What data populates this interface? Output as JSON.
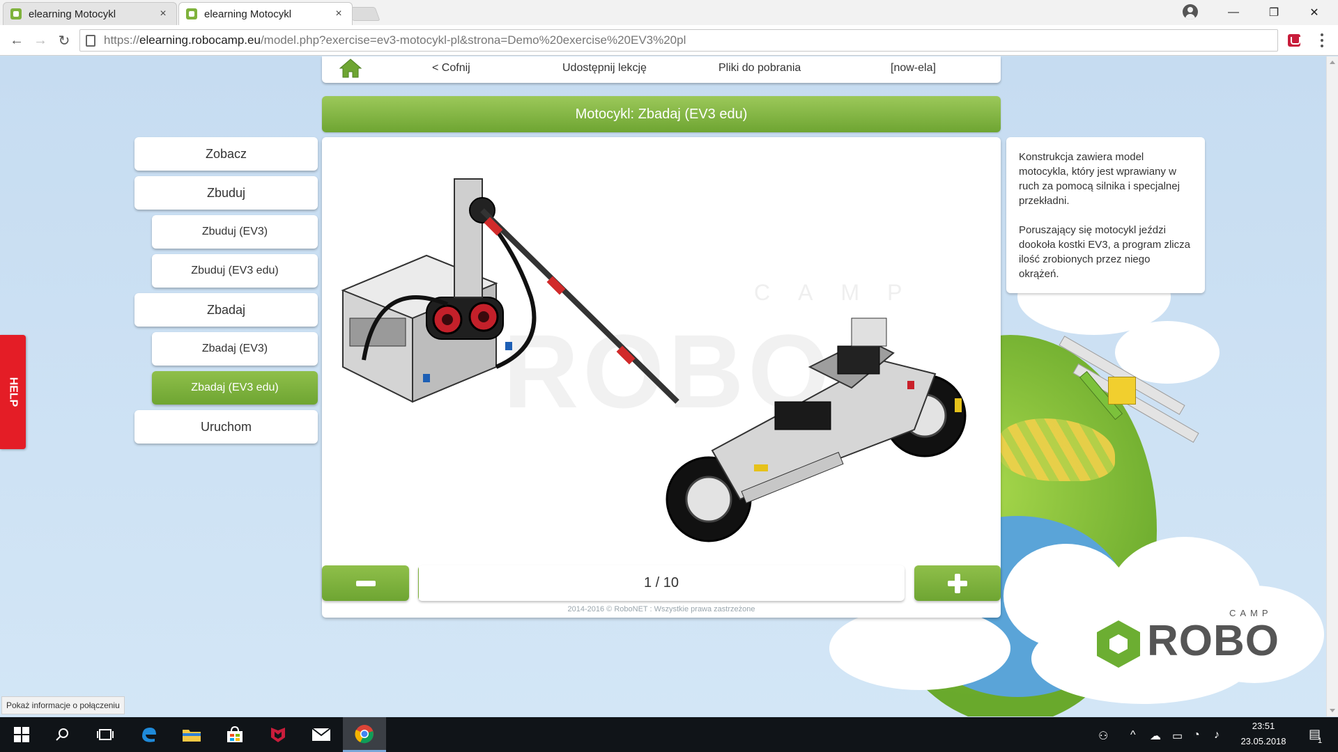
{
  "browser": {
    "tabs": [
      {
        "title": "elearning Motocykl",
        "close": "×"
      },
      {
        "title": "elearning Motocykl",
        "close": "×"
      }
    ],
    "url": {
      "scheme": "https://",
      "host": "elearning.robocamp.eu",
      "path": "/model.php?exercise=ev3-motocykl-pl&strona=Demo%20exercise%20EV3%20pl"
    },
    "window_controls": {
      "minimize": "—",
      "maximize": "❐",
      "close": "✕"
    }
  },
  "topnav": {
    "back": "< Cofnij",
    "share": "Udostępnij lekcję",
    "downloads": "Pliki do pobrania",
    "user": "[now-ela]"
  },
  "lesson": {
    "title": "Motocykl: Zbadaj (EV3 edu)"
  },
  "menu": {
    "see": "Zobacz",
    "build": "Zbuduj",
    "build_ev3": "Zbuduj (EV3)",
    "build_ev3_edu": "Zbuduj (EV3 edu)",
    "explore": "Zbadaj",
    "explore_ev3": "Zbadaj (EV3)",
    "explore_ev3_edu": "Zbadaj (EV3 edu)",
    "run": "Uruchom"
  },
  "description": {
    "p1": "Konstrukcja zawiera model motocykla, który jest wprawiany w ruch za pomocą silnika i specjalnej przekładni.",
    "p2": "Poruszający się motocykl jeździ dookoła kostki EV3, a program zlicza ilość zrobionych przez niego okrążeń."
  },
  "pager": {
    "label": "1 / 10",
    "current": 1,
    "total": 10
  },
  "footer": "2014-2016 © RoboNET : Wszystkie prawa zastrzeżone",
  "logo": {
    "robo": "ROBO",
    "camp": "CAMP"
  },
  "watermark": {
    "robo": "ROBO",
    "camp": "CAMP"
  },
  "help": "HELP",
  "status_bubble": "Pokaż informacje o połączeniu",
  "taskbar": {
    "time": "23:51",
    "date": "23.05.2018",
    "notification_count": "1"
  },
  "colors": {
    "accent_green": "#7fb23c",
    "help_red": "#e41d26",
    "page_bg": "#c9dff2"
  }
}
